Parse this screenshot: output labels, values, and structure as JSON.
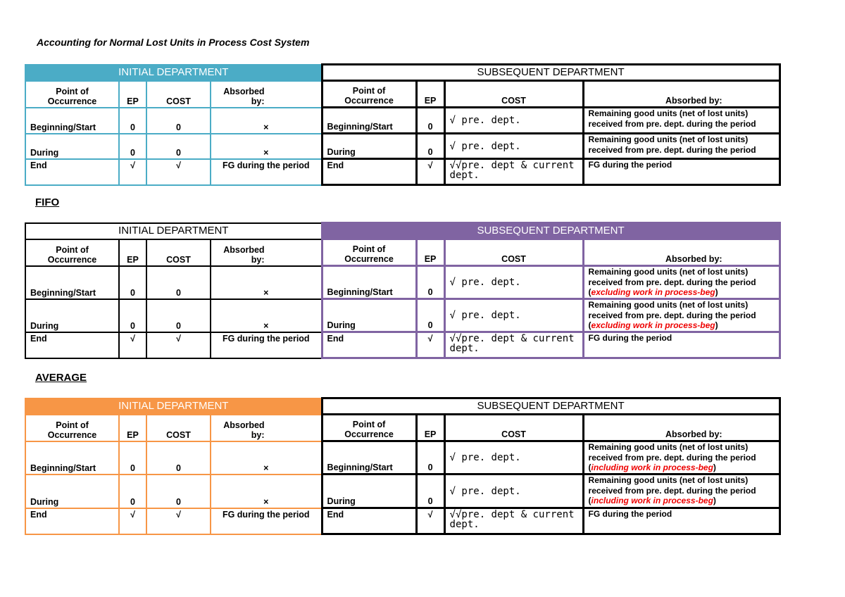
{
  "title": "Accounting for Normal Lost Units in Process Cost System",
  "colors": {
    "teal": "#4bacc6",
    "purple": "#8064a2",
    "orange": "#f79646",
    "black": "#000000",
    "note": "#ee0000"
  },
  "tables": [
    {
      "label": "",
      "initial": {
        "title": "INITIAL DEPARTMENT",
        "color": "#4bacc6",
        "headers": [
          "Point of Occurrence",
          "EP",
          "COST",
          "Absorbed by:"
        ],
        "rows": [
          [
            "Beginning/Start",
            "0",
            "0",
            "×"
          ],
          [
            "During",
            "0",
            "0",
            "×"
          ],
          [
            "End",
            "√",
            "√",
            "FG during the period"
          ]
        ]
      },
      "subsequent": {
        "title": "SUBSEQUENT DEPARTMENT",
        "color": "#000000",
        "headers": [
          "Point of Occurrence",
          "EP",
          "COST",
          "Absorbed by:"
        ],
        "rows": [
          {
            "point": "Beginning/Start",
            "ep": "0",
            "cost": "√ pre. dept.",
            "absorbed": "Remaining good units (net of lost units) received from pre. dept. during the period",
            "note": ""
          },
          {
            "point": "During",
            "ep": "0",
            "cost": "√ pre. dept.",
            "absorbed": "Remaining good units (net of lost units) received from pre. dept. during the period",
            "note": ""
          },
          {
            "point": "End",
            "ep": "√",
            "cost": "√√pre. dept & current dept.",
            "absorbed": "FG during the period",
            "note": ""
          }
        ]
      }
    },
    {
      "label": "FIFO",
      "initial": {
        "title": "INITIAL DEPARTMENT",
        "color": "#000000",
        "headers": [
          "Point of Occurrence",
          "EP",
          "COST",
          "Absorbed by:"
        ],
        "rows": [
          [
            "Beginning/Start",
            "0",
            "0",
            "×"
          ],
          [
            "During",
            "0",
            "0",
            "×"
          ],
          [
            "End",
            "√",
            "√",
            "FG during the period"
          ]
        ]
      },
      "subsequent": {
        "title": "SUBSEQUENT DEPARTMENT",
        "color": "#8064a2",
        "headers": [
          "Point of Occurrence",
          "EP",
          "COST",
          "Absorbed by:"
        ],
        "rows": [
          {
            "point": "Beginning/Start",
            "ep": "0",
            "cost": "√ pre. dept.",
            "absorbed": "Remaining good units (net of lost units) received from pre. dept. during the period",
            "note": "excluding work in process-beg"
          },
          {
            "point": "During",
            "ep": "0",
            "cost": "√ pre. dept.",
            "absorbed": "Remaining good units (net of lost units) received from pre. dept. during the period",
            "note": "excluding work in process-beg"
          },
          {
            "point": "End",
            "ep": "√",
            "cost": "√√pre. dept & current dept.",
            "absorbed": "FG during the period",
            "note": ""
          }
        ]
      }
    },
    {
      "label": "AVERAGE",
      "initial": {
        "title": "INITIAL DEPARTMENT",
        "color": "#f79646",
        "headers": [
          "Point of Occurrence",
          "EP",
          "COST",
          "Absorbed by:"
        ],
        "rows": [
          [
            "Beginning/Start",
            "0",
            "0",
            "×"
          ],
          [
            "During",
            "0",
            "0",
            "×"
          ],
          [
            "End",
            "√",
            "√",
            "FG during the period"
          ]
        ]
      },
      "subsequent": {
        "title": "SUBSEQUENT DEPARTMENT",
        "color": "#000000",
        "headers": [
          "Point of Occurrence",
          "EP",
          "COST",
          "Absorbed by:"
        ],
        "rows": [
          {
            "point": "Beginning/Start",
            "ep": "0",
            "cost": "√ pre. dept.",
            "absorbed": "Remaining good units (net of lost units) received from pre. dept. during the period",
            "note": "including work in process-beg"
          },
          {
            "point": "During",
            "ep": "0",
            "cost": "√ pre. dept.",
            "absorbed": "Remaining good units (net of lost units) received from pre. dept. during the period",
            "note": "including work in process-beg"
          },
          {
            "point": "End",
            "ep": "√",
            "cost": "√√pre. dept & current dept.",
            "absorbed": "FG during the period",
            "note": ""
          }
        ]
      }
    }
  ]
}
